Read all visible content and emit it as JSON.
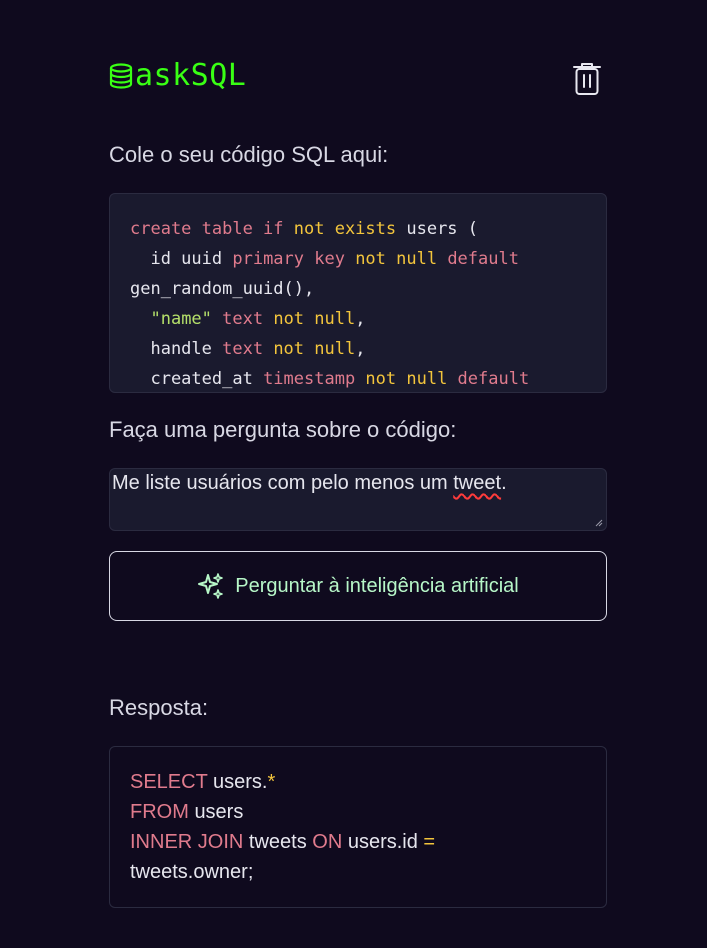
{
  "header": {
    "logo_text": "askSQL",
    "brand_color": "#39ff14",
    "logo_icon": "database-icon",
    "delete_icon": "trash-icon"
  },
  "code_section": {
    "label": "Cole o seu código SQL aqui:",
    "lines": [
      [
        {
          "t": "create table if ",
          "c": "kw"
        },
        {
          "t": "not exists ",
          "c": "kw2"
        },
        {
          "t": "users (",
          "c": "plain"
        }
      ],
      [
        {
          "t": "  id uuid ",
          "c": "plain"
        },
        {
          "t": "primary key ",
          "c": "kw"
        },
        {
          "t": "not null ",
          "c": "kw2"
        },
        {
          "t": "default",
          "c": "kw"
        }
      ],
      [
        {
          "t": "gen_random_uuid(),",
          "c": "plain"
        }
      ],
      [
        {
          "t": "  ",
          "c": "plain"
        },
        {
          "t": "\"name\"",
          "c": "str"
        },
        {
          "t": " text ",
          "c": "kw"
        },
        {
          "t": "not null",
          "c": "kw2"
        },
        {
          "t": ",",
          "c": "plain"
        }
      ],
      [
        {
          "t": "  handle ",
          "c": "plain"
        },
        {
          "t": "text ",
          "c": "kw"
        },
        {
          "t": "not null",
          "c": "kw2"
        },
        {
          "t": ",",
          "c": "plain"
        }
      ],
      [
        {
          "t": "  created_at ",
          "c": "plain"
        },
        {
          "t": "timestamp ",
          "c": "kw"
        },
        {
          "t": "not null ",
          "c": "kw2"
        },
        {
          "t": "default",
          "c": "kw"
        }
      ]
    ]
  },
  "question_section": {
    "label": "Faça uma pergunta sobre o código:",
    "value_before": "Me liste usuários com pelo menos um ",
    "value_misspelled": "tweet",
    "value_after": "."
  },
  "ask_button": {
    "label": "Perguntar à inteligência artificial",
    "icon": "sparkles-icon"
  },
  "answer_section": {
    "label": "Resposta:",
    "lines": [
      [
        {
          "t": "SELECT ",
          "c": "kw"
        },
        {
          "t": "users.",
          "c": "plain"
        },
        {
          "t": "*",
          "c": "kw2"
        }
      ],
      [
        {
          "t": "FROM ",
          "c": "kw"
        },
        {
          "t": "users",
          "c": "plain"
        }
      ],
      [
        {
          "t": "INNER JOIN ",
          "c": "kw"
        },
        {
          "t": "tweets ",
          "c": "plain"
        },
        {
          "t": "ON ",
          "c": "kw"
        },
        {
          "t": "users.id ",
          "c": "plain"
        },
        {
          "t": "=",
          "c": "kw2"
        }
      ],
      [
        {
          "t": "tweets.owner;",
          "c": "plain"
        }
      ]
    ]
  },
  "colors": {
    "background": "#0f0a1e",
    "keyword": "#e07b8d",
    "keyword_alt": "#f3c53c",
    "string": "#b5e06a",
    "button_text": "#b7f7c8"
  }
}
